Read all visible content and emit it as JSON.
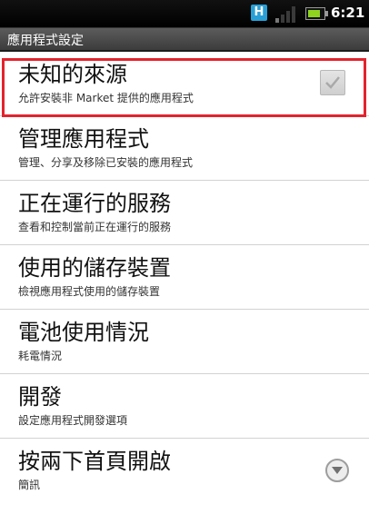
{
  "status_bar": {
    "h_icon": "H",
    "icons": [
      "h-icon",
      "signal-icon",
      "battery-icon"
    ],
    "time": "6:21"
  },
  "title_bar": {
    "title": "應用程式設定"
  },
  "settings": [
    {
      "title": "未知的來源",
      "subtitle": "允許安裝非 Market 提供的應用程式",
      "control": "checkbox",
      "checked": false
    },
    {
      "title": "管理應用程式",
      "subtitle": "管理、分享及移除已安裝的應用程式"
    },
    {
      "title": "正在運行的服務",
      "subtitle": "查看和控制當前正在運行的服務"
    },
    {
      "title": "使用的儲存裝置",
      "subtitle": "檢視應用程式使用的儲存裝置"
    },
    {
      "title": "電池使用情況",
      "subtitle": "耗電情況"
    },
    {
      "title": "開發",
      "subtitle": "設定應用程式開發選項"
    },
    {
      "title": "按兩下首頁開啟",
      "subtitle": "簡訊",
      "control": "dropdown"
    }
  ],
  "colors": {
    "highlight": "#e3232d",
    "h_icon": "#2a9fd6",
    "battery": "#8fd41f"
  }
}
